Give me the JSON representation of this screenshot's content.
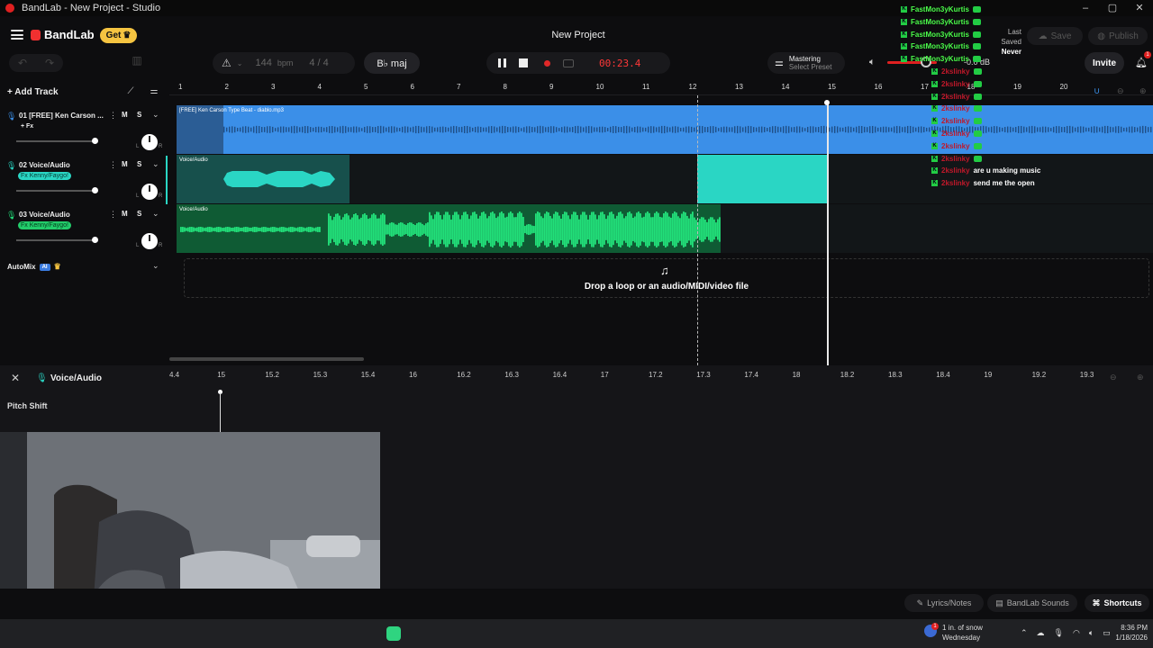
{
  "window": {
    "title": "BandLab - New Project - Studio",
    "minimize": "–",
    "maximize": "▢",
    "close": "✕"
  },
  "header": {
    "logo": "BandLab",
    "get_label": "Get",
    "project_title": "New Project",
    "last_saved_label": "Last Saved",
    "last_saved_value": "Never",
    "save_label": "Save",
    "publish_label": "Publish",
    "invite_label": "Invite",
    "notification_count": "1"
  },
  "toolbar": {
    "tempo": "144",
    "tempo_unit": "bpm",
    "time_signature": "4 / 4",
    "key": "B♭ maj",
    "timecode": "00:23.4",
    "mastering_title": "Mastering",
    "mastering_sub": "Select Preset",
    "volume_db": "-0.0 dB"
  },
  "tracks_panel": {
    "add_track_label": "Add Track",
    "tracks": [
      {
        "number": "01",
        "name": "[FREE] Ken Carson ...",
        "fx": "+ Fx",
        "mute": "M",
        "solo": "S",
        "volume": 0.83
      },
      {
        "number": "02",
        "name": "Voice/Audio",
        "fx": "Fx Kenny/Faygo!",
        "mute": "M",
        "solo": "S",
        "volume": 0.83
      },
      {
        "number": "03",
        "name": "Voice/Audio",
        "fx": "Fx Kenny/Faygo!",
        "mute": "M",
        "solo": "S",
        "volume": 0.83
      }
    ],
    "pan_L": "L",
    "pan_R": "R",
    "automix_label": "AutoMix",
    "ai_badge": "AI"
  },
  "timeline": {
    "bars": [
      "1",
      "2",
      "3",
      "4",
      "5",
      "6",
      "7",
      "8",
      "9",
      "10",
      "11",
      "12",
      "13",
      "14",
      "15",
      "16",
      "17",
      "18",
      "19",
      "20"
    ],
    "clip1_name": "[FREE] Ken Carson Type Beat - diablo.mp3",
    "clip2_name": "Voice/Audio",
    "clip3_name": "Voice/Audio",
    "drop_text": "Drop a loop or an audio/MIDI/video file"
  },
  "editor": {
    "track_name": "Voice/Audio",
    "ruler": [
      "4.4",
      "15",
      "15.2",
      "15.3",
      "15.4",
      "16",
      "16.2",
      "16.3",
      "16.4",
      "17",
      "17.2",
      "17.3",
      "17.4",
      "18",
      "18.2",
      "18.3",
      "18.4",
      "19",
      "19.2",
      "19.3"
    ],
    "section_label": "Pitch Shift"
  },
  "chat": [
    {
      "user": "FastMon3yKurtis",
      "msg": "",
      "type": "u1"
    },
    {
      "user": "FastMon3yKurtis",
      "msg": "",
      "type": "u1"
    },
    {
      "user": "FastMon3yKurtis",
      "msg": "",
      "type": "u1"
    },
    {
      "user": "FastMon3yKurtis",
      "msg": "",
      "type": "u1"
    },
    {
      "user": "FastMon3yKurtis",
      "msg": "",
      "type": "u1"
    },
    {
      "user": "2kslinky",
      "msg": "",
      "type": "u2"
    },
    {
      "user": "2kslinky",
      "msg": "",
      "type": "u2"
    },
    {
      "user": "2kslinky",
      "msg": "",
      "type": "u2"
    },
    {
      "user": "2kslinky",
      "msg": "",
      "type": "u2"
    },
    {
      "user": "2kslinky",
      "msg": "",
      "type": "u2"
    },
    {
      "user": "2kslinky",
      "msg": "",
      "type": "u2"
    },
    {
      "user": "2kslinky",
      "msg": "",
      "type": "u2"
    },
    {
      "user": "2kslinky",
      "msg": "",
      "type": "u2"
    },
    {
      "user": "2kslinky",
      "msg": "are u making music",
      "type": "u2"
    },
    {
      "user": "2kslinky",
      "msg": "send me the open",
      "type": "u2"
    }
  ],
  "footer": {
    "lyrics_label": "Lyrics/Notes",
    "sounds_label": "BandLab Sounds",
    "shortcuts_label": "Shortcuts"
  },
  "taskbar": {
    "weather_line1": "1 in. of snow",
    "weather_line2": "Wednesday",
    "weather_badge": "1",
    "time": "8:36 PM",
    "date": "1/18/2026"
  },
  "colors": {
    "accent": "#2ad6c4",
    "beat": "#3b8fe8",
    "vocal": "#2ad6c4",
    "vocal2": "#22e07a",
    "record": "#e02828",
    "get": "#f5c441"
  }
}
